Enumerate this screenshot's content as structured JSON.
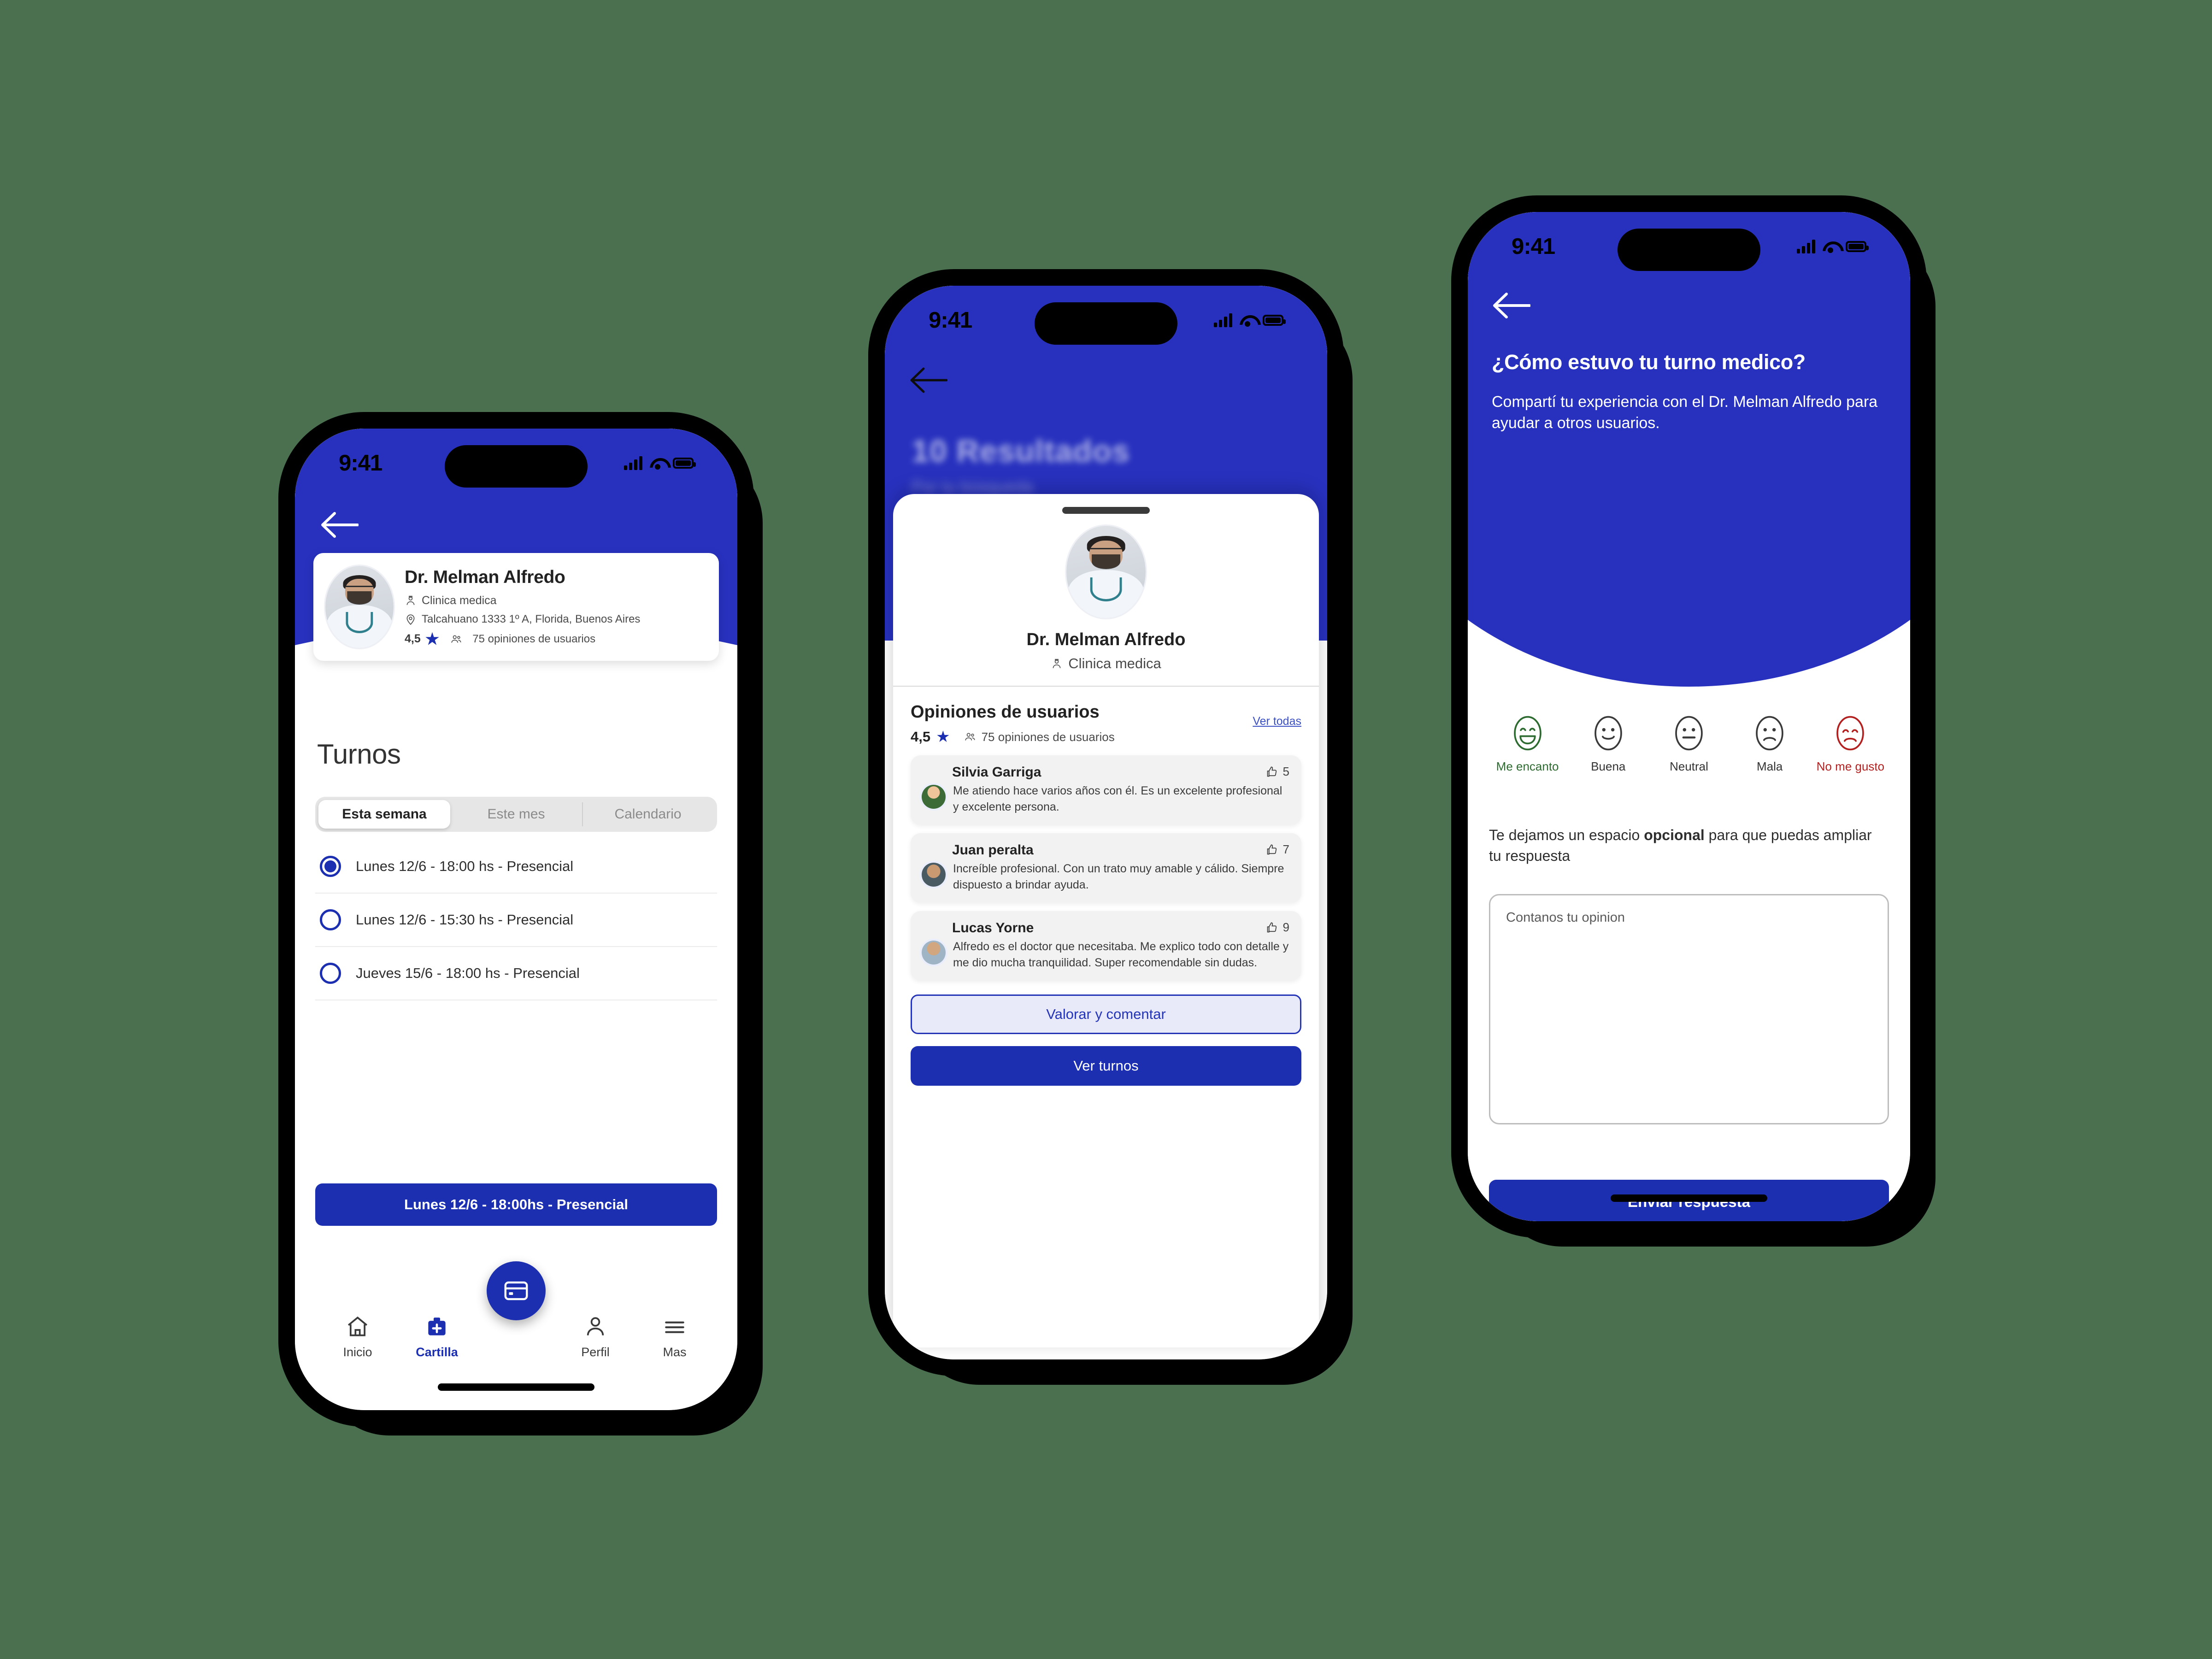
{
  "theme": {
    "brand_blue": "#2731be",
    "deep_blue": "#1c2fb0",
    "background_green": "#4a7050",
    "good_green": "#2d6b30",
    "bad_red": "#b32020"
  },
  "status_bar": {
    "time": "9:41"
  },
  "phone1": {
    "doctor": {
      "name": "Dr. Melman Alfredo",
      "specialty": "Clinica medica",
      "address": "Talcahuano 1333 1º A, Florida, Buenos Aires",
      "rating": "4,5",
      "reviews_label": "75 opiniones de usuarios"
    },
    "section_title": "Turnos",
    "tabs": [
      {
        "label": "Esta semana",
        "active": true
      },
      {
        "label": "Este mes",
        "active": false
      },
      {
        "label": "Calendario",
        "active": false
      }
    ],
    "slots": [
      {
        "label": "Lunes 12/6 - 18:00 hs - Presencial",
        "selected": true
      },
      {
        "label": "Lunes 12/6 - 15:30 hs - Presencial",
        "selected": false
      },
      {
        "label": "Jueves 15/6 - 18:00 hs - Presencial",
        "selected": false
      }
    ],
    "cta_label": "Lunes 12/6 - 18:00hs - Presencial",
    "tabbar": [
      {
        "label": "Inicio",
        "icon": "home-icon",
        "active": false
      },
      {
        "label": "Cartilla",
        "icon": "medical-kit-icon",
        "active": true
      },
      {
        "label": "Perfil",
        "icon": "person-icon",
        "active": false
      },
      {
        "label": "Mas",
        "icon": "hamburger-icon",
        "active": false
      }
    ],
    "fab_icon": "card-icon"
  },
  "phone2": {
    "background_title": "10 Resultados",
    "background_subtitle": "Por tu búsqueda",
    "doctor": {
      "name": "Dr. Melman Alfredo",
      "specialty": "Clinica medica"
    },
    "reviews_header": "Opiniones de usuarios",
    "see_all_label": "Ver todas",
    "rating": "4,5",
    "reviews_count_label": "75 opiniones de usuarios",
    "reviews": [
      {
        "name": "Silvia Garriga",
        "likes": "5",
        "text": "Me atiendo hace varios años con él. Es un excelente profesional y excelente persona."
      },
      {
        "name": "Juan peralta",
        "likes": "7",
        "text": "Increíble profesional. Con un trato muy amable y cálido. Siempre dispuesto a brindar ayuda."
      },
      {
        "name": "Lucas Yorne",
        "likes": "9",
        "text": "Alfredo es el doctor que necesitaba. Me explico todo con detalle y me dio mucha tranquilidad. Super recomendable sin dudas."
      }
    ],
    "secondary_button": "Valorar y comentar",
    "primary_button": "Ver turnos"
  },
  "phone3": {
    "question": "¿Cómo estuvo tu turno medico?",
    "subtitle": "Compartí tu experiencia con el Dr. Melman Alfredo para ayudar a otros usuarios.",
    "faces": [
      {
        "label": "Me encanto",
        "icon": "grinning-face-icon",
        "tone": "good"
      },
      {
        "label": "Buena",
        "icon": "smiling-face-icon",
        "tone": "neutral"
      },
      {
        "label": "Neutral",
        "icon": "neutral-face-icon",
        "tone": "neutral"
      },
      {
        "label": "Mala",
        "icon": "frowning-face-icon",
        "tone": "neutral"
      },
      {
        "label": "No me gusto",
        "icon": "sad-face-icon",
        "tone": "bad"
      }
    ],
    "optional_prefix": "Te dejamos un espacio ",
    "optional_bold": "opcional",
    "optional_suffix": " para que puedas ampliar tu respuesta",
    "textarea_placeholder": "Contanos tu opinion",
    "submit_label": "Enviar respuesta"
  }
}
